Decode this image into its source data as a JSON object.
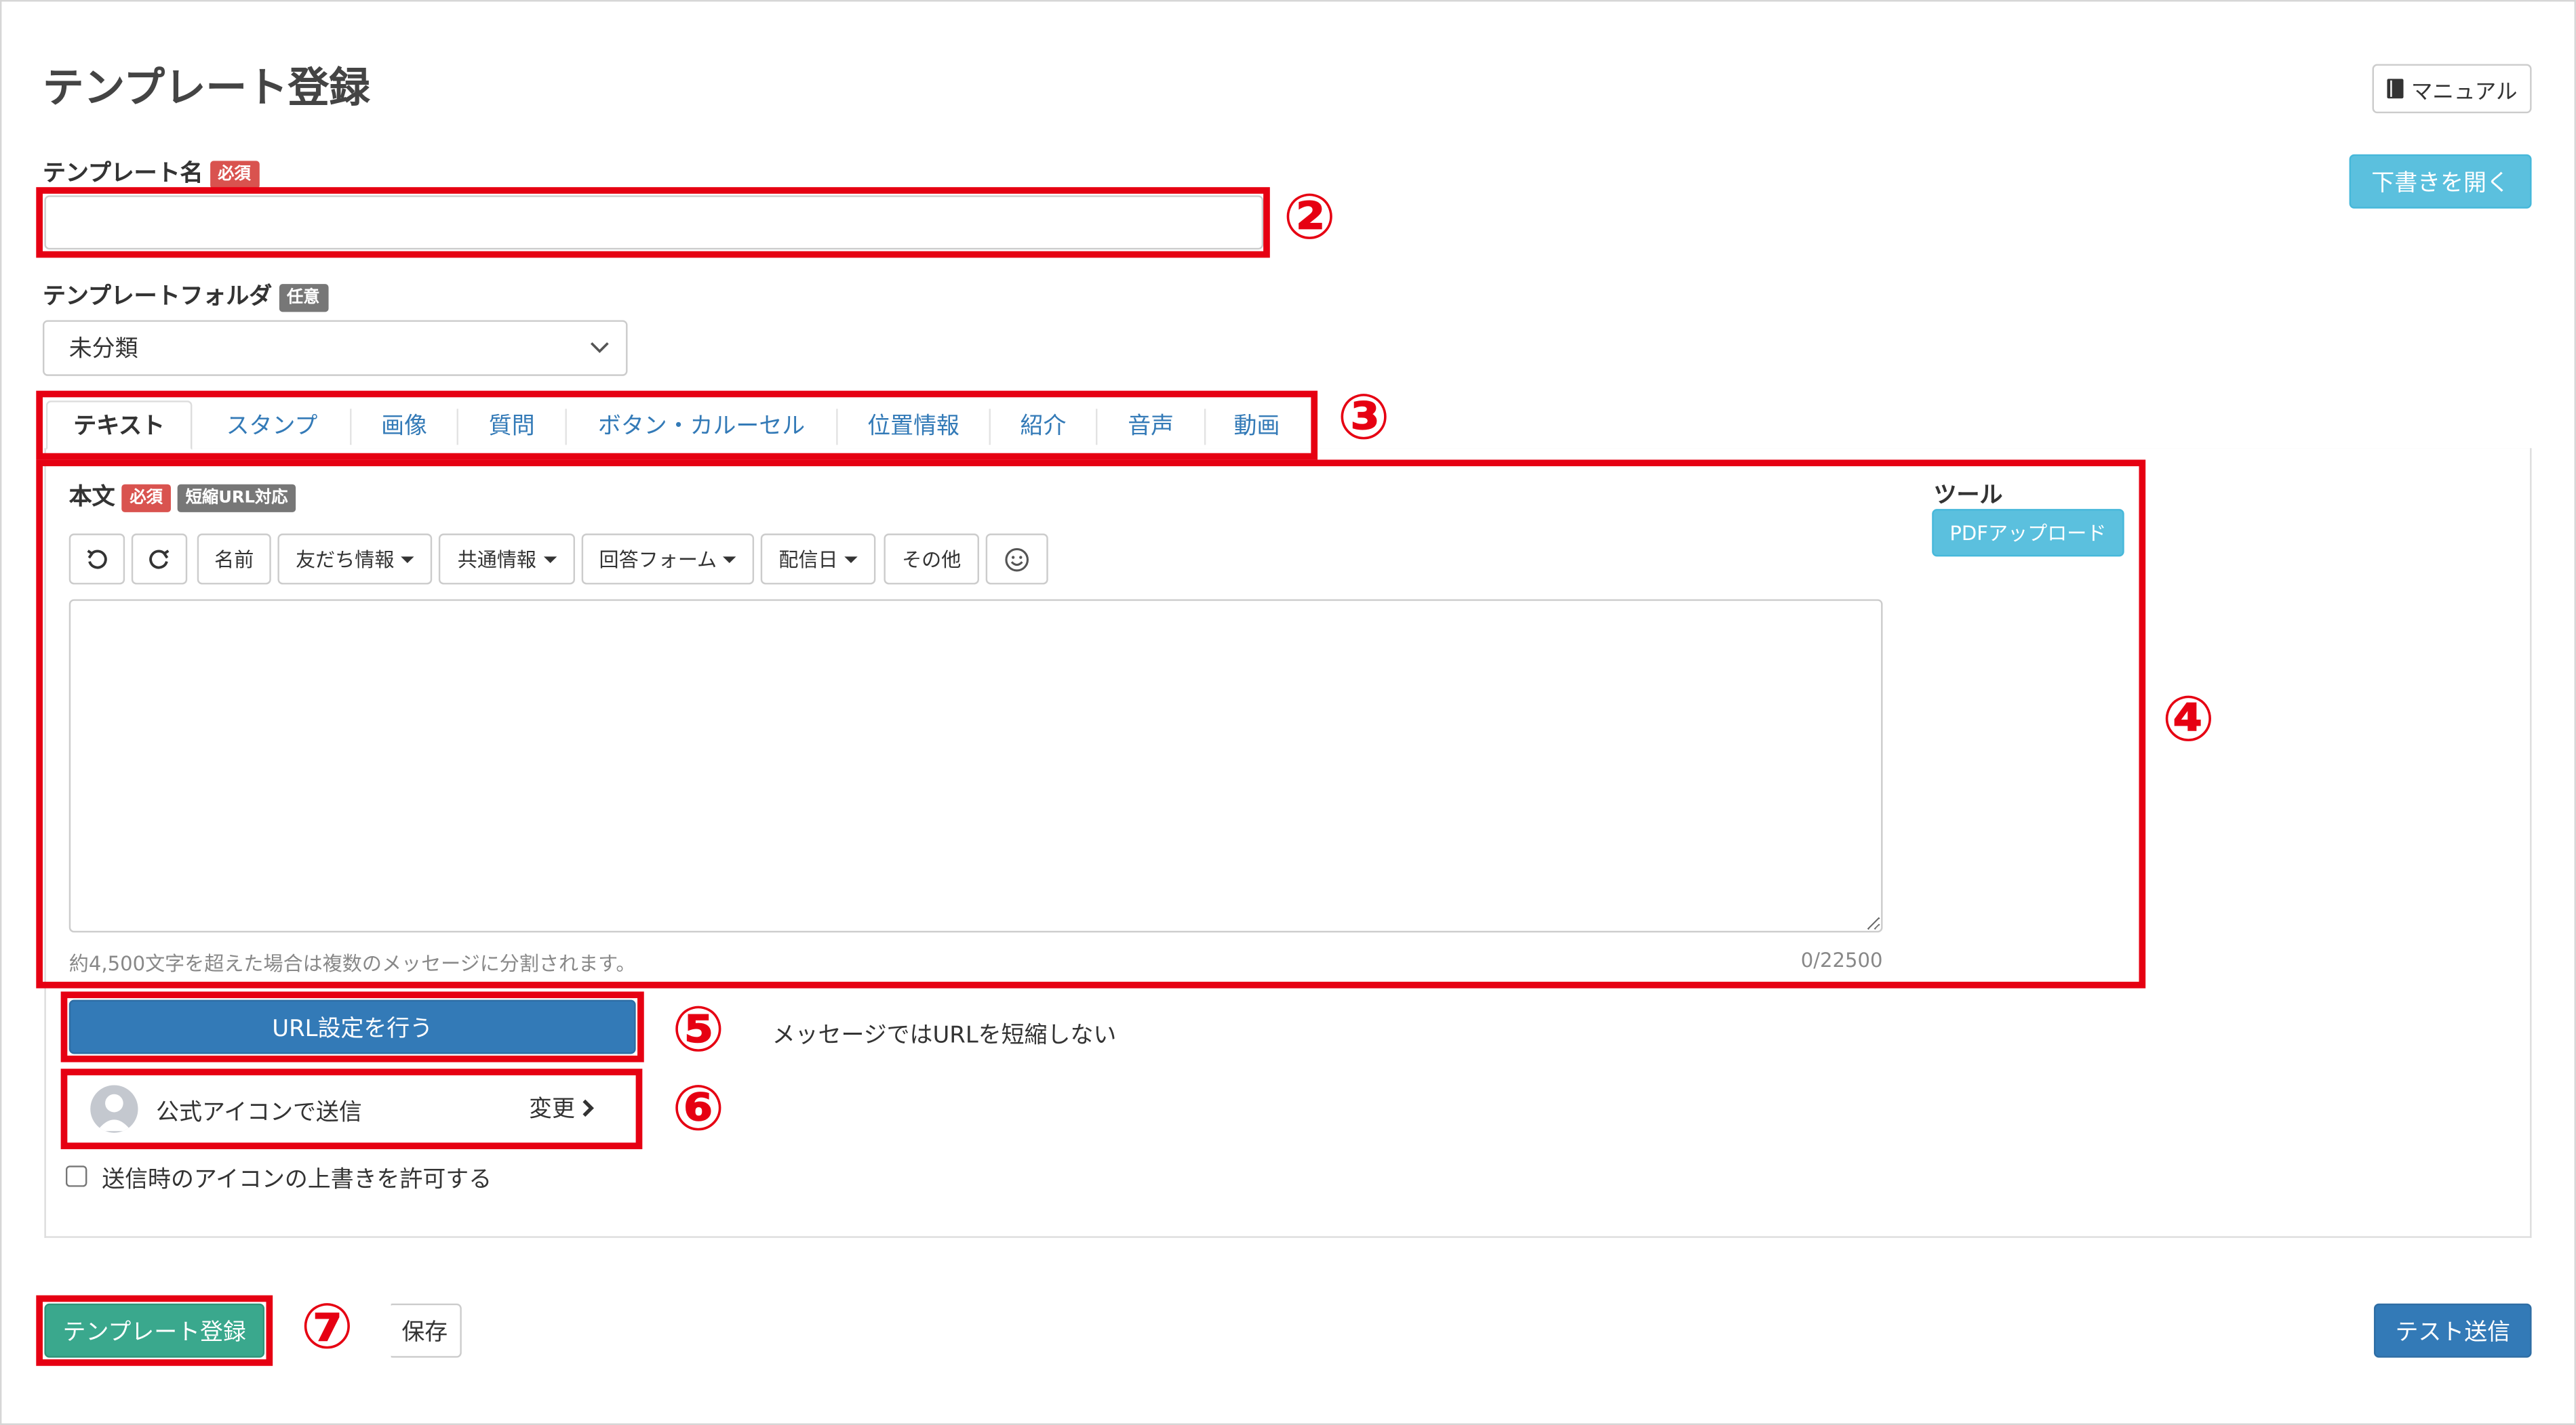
{
  "page_title": "テンプレート登録",
  "header": {
    "manual_button": "マニュアル",
    "draft_button": "下書きを開く"
  },
  "form": {
    "name_label": "テンプレート名",
    "name_badge": "必須",
    "name_value": "",
    "folder_label": "テンプレートフォルダ",
    "folder_badge": "任意",
    "folder_selected": "未分類"
  },
  "tabs": [
    "テキスト",
    "スタンプ",
    "画像",
    "質問",
    "ボタン・カルーセル",
    "位置情報",
    "紹介",
    "音声",
    "動画"
  ],
  "editor": {
    "body_label": "本文",
    "body_badge_required": "必須",
    "body_badge_shorturl": "短縮URL対応",
    "toolbar": {
      "undo_icon": "undo-icon",
      "redo_icon": "redo-icon",
      "name": "名前",
      "friend_info": "友だち情報",
      "shared_info": "共通情報",
      "answer_form": "回答フォーム",
      "delivery_date": "配信日",
      "other": "その他",
      "emoji_icon": "smile-icon"
    },
    "textarea_value": "",
    "hint": "約4,500文字を超えた場合は複数のメッセージに分割されます。",
    "counter": "0/22500",
    "tools_label": "ツール",
    "pdf_upload_button": "PDFアップロード"
  },
  "url_settings": {
    "button": "URL設定を行う",
    "note": "メッセージではURLを短縮しない"
  },
  "sender": {
    "label": "公式アイコンで送信",
    "change": "変更",
    "checkbox_label": "送信時のアイコンの上書きを許可する",
    "checkbox_checked": false
  },
  "footer": {
    "register_button": "テンプレート登録",
    "save_button": "保存",
    "test_send_button": "テスト送信"
  },
  "annotations": [
    "②",
    "③",
    "④",
    "⑤",
    "⑥",
    "⑦"
  ],
  "colors": {
    "highlight": "#e60012",
    "primary": "#337ab7",
    "info": "#5bc0de",
    "success": "#3aa88d",
    "badge_required": "#d9534f",
    "badge_optional": "#777777"
  }
}
